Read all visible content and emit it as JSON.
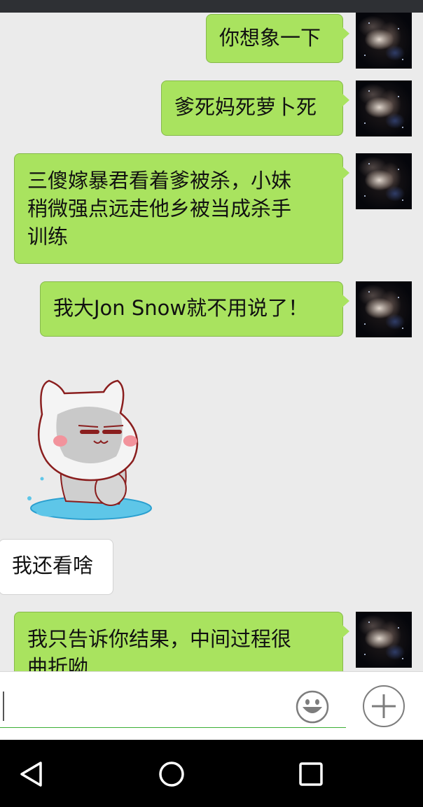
{
  "messages": [
    {
      "side": "right",
      "text": "你想象一下"
    },
    {
      "side": "right",
      "text": "爹死妈死萝卜死"
    },
    {
      "side": "right",
      "lines": [
        "三傻嫁暴君看着爹被杀，小妹",
        "稍微强点远走他乡被当成杀手",
        "训练"
      ]
    },
    {
      "side": "right",
      "text": "我大Jon Snow就不用说了！"
    },
    {
      "side": "left",
      "type": "sticker",
      "sticker": "crying-cat-sticker"
    },
    {
      "side": "left",
      "text": "我还看啥"
    },
    {
      "side": "right",
      "lines": [
        "我只告诉你结果，中间过程很",
        "曲折呦"
      ]
    }
  ],
  "input": {
    "value": "",
    "placeholder": ""
  },
  "icons": {
    "emoji": "smiley-face-icon",
    "more": "plus-circle-icon",
    "back": "back-triangle-icon",
    "home": "home-circle-icon",
    "recents": "recents-square-icon"
  },
  "colors": {
    "sent_bubble": "#a9e35f",
    "received_bubble": "#ffffff",
    "chat_background": "#ebebeb",
    "input_underline": "#3cb034"
  }
}
